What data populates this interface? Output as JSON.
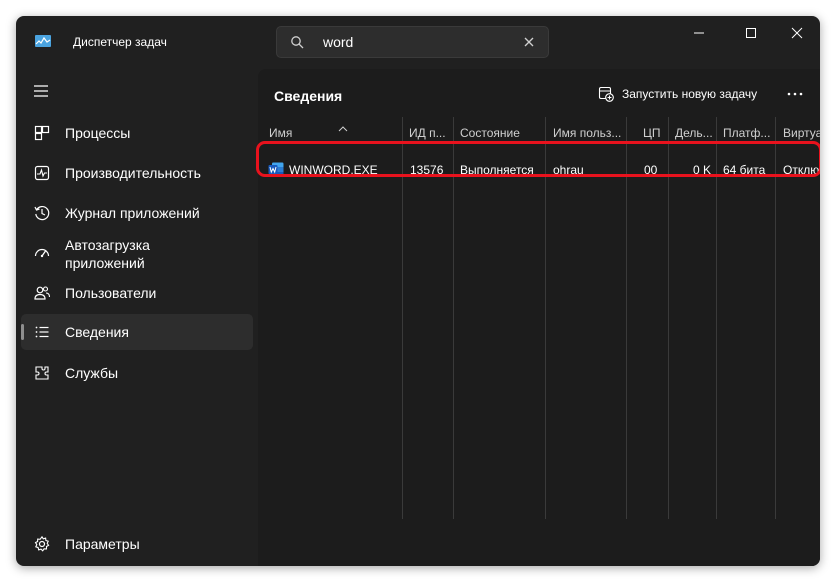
{
  "window": {
    "title": "Диспетчер задач",
    "search": {
      "value": "word",
      "placeholder": ""
    }
  },
  "sidebar": {
    "items": [
      {
        "label": "Процессы",
        "icon": "processes-icon"
      },
      {
        "label": "Производительность",
        "icon": "performance-icon"
      },
      {
        "label": "Журнал приложений",
        "icon": "app-history-icon"
      },
      {
        "label": "Автозагрузка приложений",
        "icon": "startup-apps-icon"
      },
      {
        "label": "Пользователи",
        "icon": "users-icon"
      },
      {
        "label": "Сведения",
        "icon": "details-icon",
        "active": true
      },
      {
        "label": "Службы",
        "icon": "services-icon"
      }
    ],
    "settings_label": "Параметры"
  },
  "main": {
    "title": "Сведения",
    "run_task_label": "Запустить новую задачу",
    "table": {
      "columns": [
        "Имя",
        "ИД п...",
        "Состояние",
        "Имя польз...",
        "ЦП",
        "Дель...",
        "Платф...",
        "Виртуа..."
      ],
      "rows": [
        {
          "name": "WINWORD.EXE",
          "pid": "13576",
          "status": "Выполняется",
          "user": "ohrau",
          "cpu": "00",
          "delta": "0 K",
          "platform": "64 бита",
          "virtualization": "Отклю"
        }
      ]
    }
  },
  "colors": {
    "window_bg": "#202020",
    "panel_bg": "#1c1c1c",
    "highlight": "#e8121d",
    "word_blue": "#185abd"
  }
}
